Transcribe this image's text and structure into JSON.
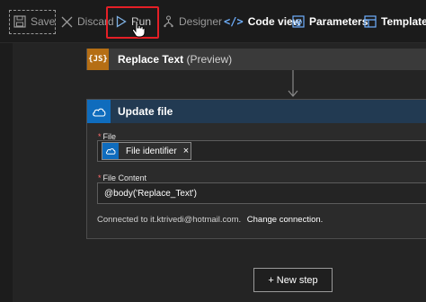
{
  "toolbar": {
    "save_label": "Save",
    "discard_label": "Discard",
    "run_label": "Run",
    "designer_label": "Designer",
    "code_view_label": "Code view",
    "parameters_label": "Parameters",
    "templates_label": "Templates"
  },
  "steps": {
    "replace_text": {
      "icon_text": "{JS}",
      "title": "Replace Text",
      "subtitle": "(Preview)"
    },
    "update_file": {
      "title": "Update file",
      "file_label": "File",
      "file_token": "File identifier",
      "file_token_close": "×",
      "content_label": "File Content",
      "content_value": "@body('Replace_Text')",
      "connection_text": "Connected to it.ktrivedi@hotmail.com.",
      "change_connection": "Change connection."
    }
  },
  "new_step_label": "+ New step",
  "colors": {
    "highlight": "#e41f26",
    "js_accent": "#b56e14",
    "onedrive_accent": "#0f6cbd"
  }
}
